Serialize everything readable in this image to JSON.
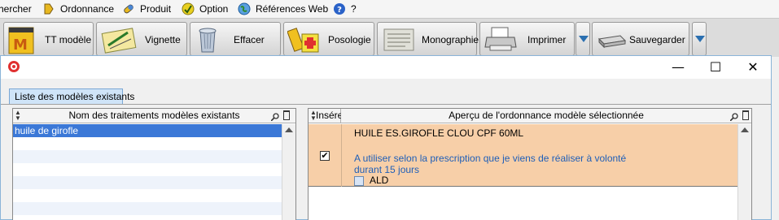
{
  "menu": {
    "items": [
      {
        "label": "chercher"
      },
      {
        "label": "Ordonnance"
      },
      {
        "label": "Produit"
      },
      {
        "label": "Option"
      },
      {
        "label": "Références Web"
      },
      {
        "label": "?"
      }
    ]
  },
  "toolbar": {
    "buttons": [
      {
        "label": "TT modèle"
      },
      {
        "label": "Vignette"
      },
      {
        "label": "Effacer"
      },
      {
        "label": "Posologie"
      },
      {
        "label": "Monographie"
      },
      {
        "label": "Imprimer"
      },
      {
        "label": "Sauvegarder"
      }
    ]
  },
  "window": {
    "minimize": "—",
    "maximize": "☐",
    "close": "✕"
  },
  "tab": {
    "label": "Liste des modèles existants"
  },
  "left_panel": {
    "header": "Nom des traitements modèles existants",
    "rows": [
      "huile de girofle"
    ]
  },
  "right_panel": {
    "col_inserer": "Insérer",
    "header": "Aperçu de l'ordonnance modèle sélectionnée",
    "drug_name": "HUILE ES.GIROFLE CLOU CPF 60ML",
    "instructions_line1": "A utiliser selon la prescription que je viens de réaliser à volonté",
    "instructions_line2": "durant 15 jours",
    "ald_label": "ALD",
    "inserted_checked": true
  },
  "colors": {
    "selected_row": "#3b78d7",
    "preview_bg": "#f7cfa8",
    "instructions_text": "#1f5fb8"
  }
}
